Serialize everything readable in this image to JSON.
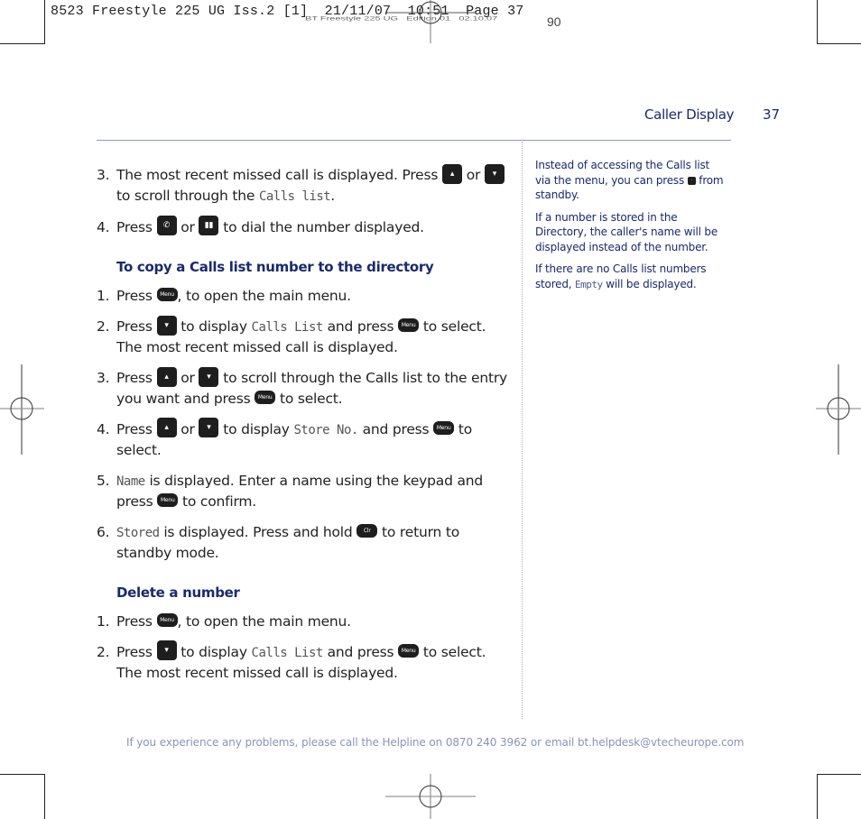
{
  "print_slug": {
    "job_line": "8523 Freestyle 225 UG Iss.2 [1]  21/11/07  10:51  Page 37",
    "underlay_text": "BT Freestyle 225 UG   Edition 01   02.10.07   ",
    "underlay_number": "90"
  },
  "header": {
    "section_title": "Caller Display",
    "page_number": "37"
  },
  "main": {
    "intro_steps": [
      {
        "num": "3.",
        "parts": [
          "The most recent missed call is displayed. Press",
          "or",
          "to scroll through the",
          "Calls list",
          "."
        ]
      },
      {
        "num": "4.",
        "parts": [
          "Press",
          "or",
          "to dial the number displayed."
        ]
      }
    ],
    "sections": [
      {
        "heading": "To copy a Calls list number to the directory",
        "steps": [
          {
            "num": "1.",
            "parts": [
              "Press",
              ", to open the main menu."
            ]
          },
          {
            "num": "2.",
            "parts": [
              "Press",
              "to display",
              "Calls List",
              "and press",
              "to select. The most recent missed call is displayed."
            ]
          },
          {
            "num": "3.",
            "parts": [
              "Press",
              "or",
              "to scroll through the Calls list to the entry you want and press",
              "to select."
            ]
          },
          {
            "num": "4.",
            "parts": [
              "Press",
              "or",
              "to display",
              "Store No.",
              "and press",
              "to select."
            ]
          },
          {
            "num": "5.",
            "parts": [
              "Name",
              "is displayed. Enter a name using the keypad and press",
              "to confirm."
            ]
          },
          {
            "num": "6.",
            "parts": [
              "Stored",
              "is displayed. Press and hold",
              "to return to standby mode."
            ]
          }
        ]
      },
      {
        "heading": "Delete a number",
        "steps": [
          {
            "num": "1.",
            "parts": [
              "Press",
              ", to open the main menu."
            ]
          },
          {
            "num": "2.",
            "parts": [
              "Press",
              "to display",
              "Calls List",
              "and press",
              "to select. The most recent missed call is displayed."
            ]
          }
        ]
      }
    ],
    "keys": {
      "menu": "Menu",
      "clear": "Clr",
      "up_icon": "up-arrow-key-icon",
      "down_icon": "down-calls-key-icon",
      "talk_icon": "talk-handset-key-icon",
      "redial_icon": "redial-key-icon"
    }
  },
  "sidebar_notes": [
    {
      "parts": [
        "Instead of accessing the Calls list via the menu, you can press",
        "from standby."
      ]
    },
    {
      "parts": [
        "If a number is stored in the Directory, the caller's name will be displayed instead of the number."
      ]
    },
    {
      "parts": [
        "If there are no Calls list numbers stored,",
        "Empty",
        "will be displayed."
      ]
    }
  ],
  "footer": {
    "helpline": "If you experience any problems, please call the Helpline on 0870 240 3962 or email bt.helpdesk@vtecheurope.com"
  },
  "colors": {
    "heading_blue": "#1a2a6c",
    "rule": "#8e9abd",
    "footer_text": "#8a93b8"
  }
}
